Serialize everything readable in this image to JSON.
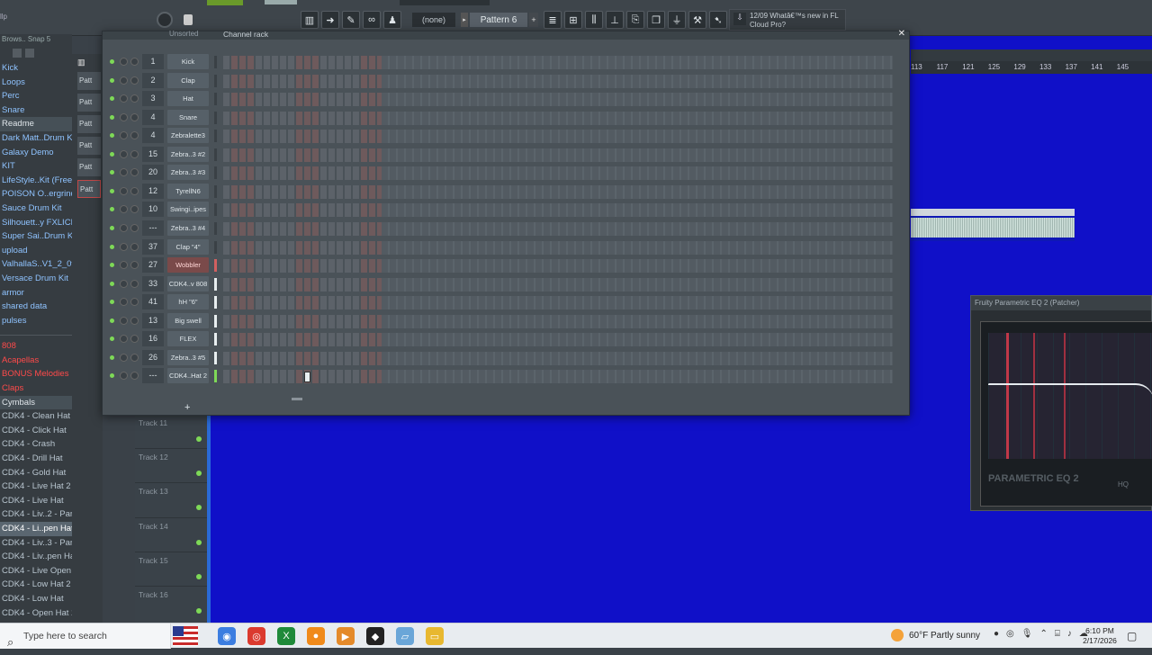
{
  "toolbar": {
    "tag": "llp",
    "pattern_none": "(none)",
    "pattern_label": "Pattern 6",
    "news_date": "12/09",
    "news_text": "Whatâ€™s new in FL",
    "news_text2": "Cloud Pro?",
    "icons": [
      "piano-icon",
      "play-icon",
      "brush-icon",
      "link-icon",
      "stamp-icon"
    ],
    "icons2": [
      "playlist-icon",
      "channel-rack-icon",
      "mixer-icon",
      "piano-roll-icon",
      "browser-icon",
      "plugin-icon",
      "plug-icon",
      "wand-icon",
      "download-icon"
    ]
  },
  "browser": {
    "header": "Brows.. Snap 5",
    "items": [
      {
        "label": "Kick",
        "type": "folder"
      },
      {
        "label": "Loops",
        "type": "folder"
      },
      {
        "label": "Perc",
        "type": "folder"
      },
      {
        "label": "Snare",
        "type": "folder"
      },
      {
        "label": "Readme",
        "type": "hdr"
      },
      {
        "label": "Dark Matt..Drum Kit",
        "type": "folder"
      },
      {
        "label": "Galaxy Demo",
        "type": "folder"
      },
      {
        "label": "KIT",
        "type": "folder"
      },
      {
        "label": "LifeStyle..Kit (Free)",
        "type": "folder"
      },
      {
        "label": "POISON O..ergrind)",
        "type": "folder"
      },
      {
        "label": "Sauce Drum Kit",
        "type": "folder"
      },
      {
        "label": "Silhouett..y FXLICIA",
        "type": "folder"
      },
      {
        "label": "Super Sai..Drum Kit",
        "type": "folder"
      },
      {
        "label": "upload",
        "type": "folder"
      },
      {
        "label": "ValhallaS..V1_2_0v2",
        "type": "folder"
      },
      {
        "label": "Versace Drum Kit",
        "type": "folder"
      },
      {
        "label": "armor",
        "type": "folder"
      },
      {
        "label": "shared data",
        "type": "folder"
      },
      {
        "label": "pulses",
        "type": "folder"
      }
    ],
    "items2": [
      {
        "label": "808",
        "type": "red"
      },
      {
        "label": "Acapellas",
        "type": "red"
      },
      {
        "label": "BONUS Melodies",
        "type": "red"
      },
      {
        "label": "Claps",
        "type": "red"
      },
      {
        "label": "Cymbals",
        "type": "redhdr"
      },
      {
        "label": "CDK4 - Clean Hat",
        "type": "file"
      },
      {
        "label": "CDK4 - Click Hat",
        "type": "file"
      },
      {
        "label": "CDK4 - Crash",
        "type": "file"
      },
      {
        "label": "CDK4 - Drill Hat",
        "type": "file"
      },
      {
        "label": "CDK4 - Gold Hat",
        "type": "file"
      },
      {
        "label": "CDK4 - Live Hat 2",
        "type": "file"
      },
      {
        "label": "CDK4 - Live Hat",
        "type": "file"
      },
      {
        "label": "CDK4 - Liv..2 - Part_1",
        "type": "file"
      },
      {
        "label": "CDK4 - Li..pen Hat 2",
        "type": "sel"
      },
      {
        "label": "CDK4 - Liv..3 - Part_1",
        "type": "file"
      },
      {
        "label": "CDK4 - Liv..pen Hat 3",
        "type": "file"
      },
      {
        "label": "CDK4 - Live Open Hat",
        "type": "file"
      },
      {
        "label": "CDK4 - Low Hat 2",
        "type": "file"
      },
      {
        "label": "CDK4 - Low Hat",
        "type": "file"
      },
      {
        "label": "CDK4 - Open Hat 2",
        "type": "file"
      }
    ]
  },
  "pattern_strip": [
    "Patt",
    "Patt",
    "Patt",
    "Patt",
    "Patt",
    "Patt"
  ],
  "rack": {
    "sort_label": "Unsorted",
    "title": "Channel rack",
    "channels": [
      {
        "num": "1",
        "name": "Kick"
      },
      {
        "num": "2",
        "name": "Clap"
      },
      {
        "num": "3",
        "name": "Hat"
      },
      {
        "num": "4",
        "name": "Snare"
      },
      {
        "num": "4",
        "name": "Zebralette3"
      },
      {
        "num": "15",
        "name": "Zebra..3 #2"
      },
      {
        "num": "20",
        "name": "Zebra..3 #3"
      },
      {
        "num": "12",
        "name": "TyrellN6"
      },
      {
        "num": "10",
        "name": "Swingi..ipes"
      },
      {
        "num": "---",
        "name": "Zebra..3 #4"
      },
      {
        "num": "37",
        "name": "Clap \"4\""
      },
      {
        "num": "27",
        "name": "Wobbler",
        "selected": true
      },
      {
        "num": "33",
        "name": "CDK4..v 808"
      },
      {
        "num": "41",
        "name": "hH \"6\""
      },
      {
        "num": "13",
        "name": "Big swell"
      },
      {
        "num": "16",
        "name": "FLEX"
      },
      {
        "num": "26",
        "name": "Zebra..3 #5"
      },
      {
        "num": "---",
        "name": "CDK4..Hat 2"
      }
    ]
  },
  "playlist": {
    "ruler": [
      "113",
      "117",
      "121",
      "125",
      "129",
      "133",
      "137",
      "141",
      "145"
    ],
    "tracks": [
      "Track 11",
      "Track 12",
      "Track 13",
      "Track 14",
      "Track 15",
      "Track 16"
    ]
  },
  "eq": {
    "title": "Fruity Parametric EQ 2 (Patcher)",
    "name": "PARAMETRIC EQ 2",
    "hq": "HQ"
  },
  "taskbar": {
    "search_placeholder": "Type here to search",
    "weather": "60°F  Partly sunny",
    "time": "6:10 PM",
    "date": "2/17/2026"
  },
  "colors": {
    "playlist_bg": "#1010c8",
    "accent_green": "#7ed957",
    "browser_red": "#ff4a4a"
  }
}
